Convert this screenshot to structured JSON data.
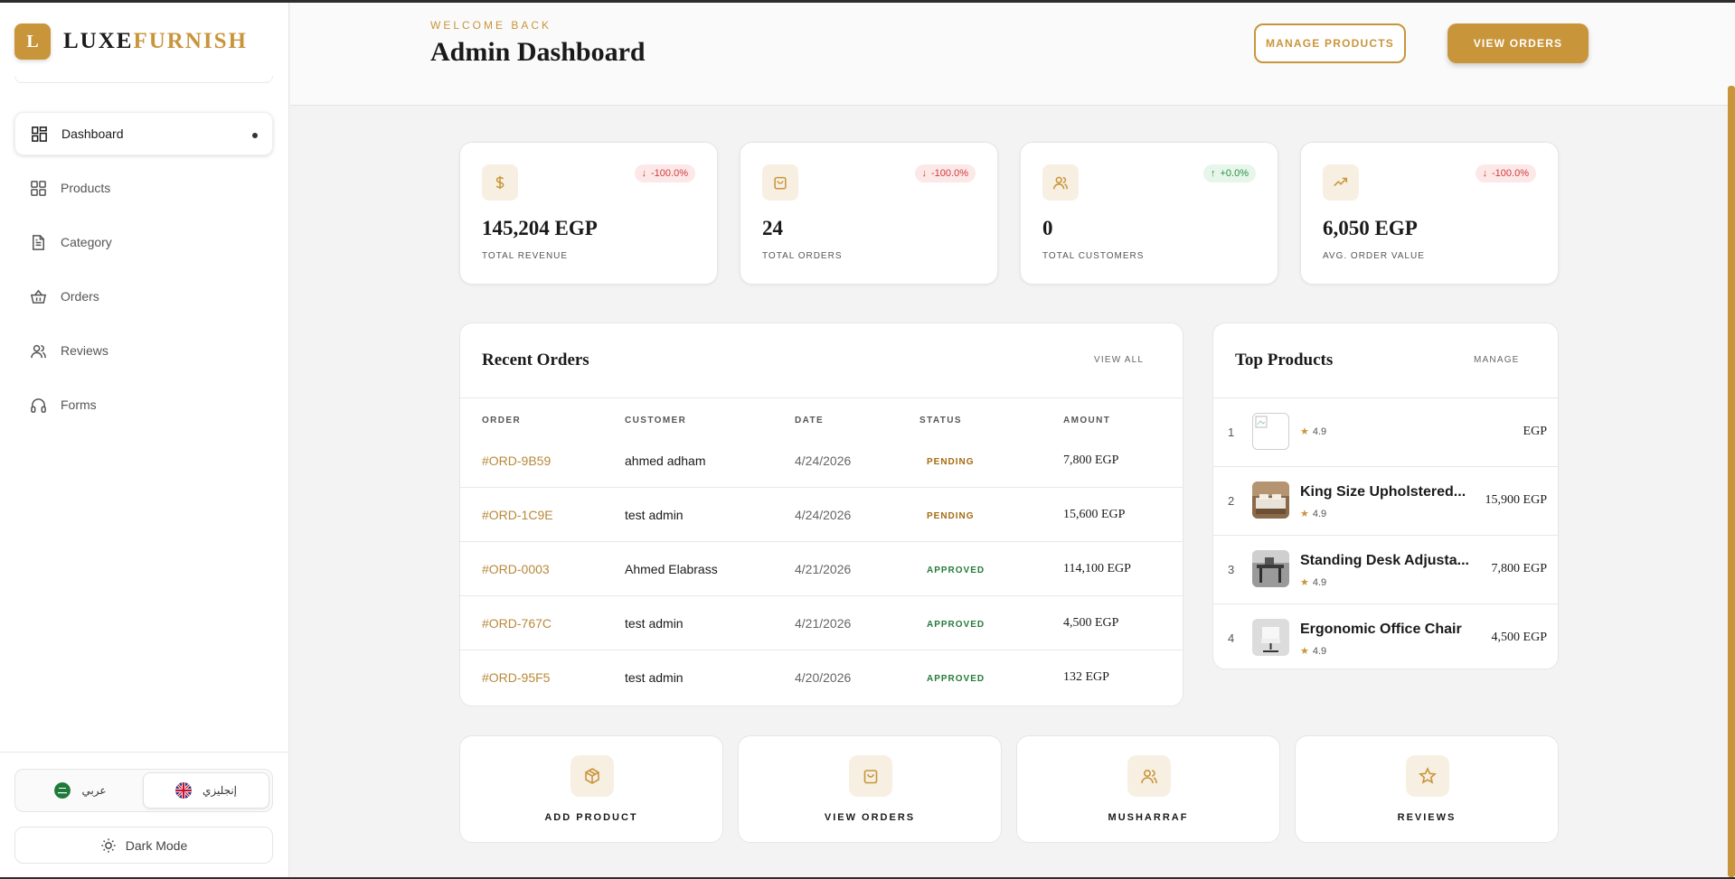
{
  "brand": {
    "logo_letter": "L",
    "name_part1": "LUXE",
    "name_part2": "FURNISH",
    "accent": "#c9953b"
  },
  "sidebar": {
    "items": [
      {
        "label": "Dashboard",
        "icon": "dashboard-icon",
        "active": true
      },
      {
        "label": "Products",
        "icon": "grid-icon"
      },
      {
        "label": "Category",
        "icon": "document-icon"
      },
      {
        "label": "Orders",
        "icon": "basket-icon"
      },
      {
        "label": "Reviews",
        "icon": "users-icon"
      },
      {
        "label": "Forms",
        "icon": "headphones-icon"
      }
    ],
    "lang_ar": "عربي",
    "lang_en": "إنجليزي",
    "dark_mode": "Dark Mode"
  },
  "header": {
    "welcome": "WELCOME BACK",
    "title": "Admin Dashboard",
    "manage_products": "MANAGE PRODUCTS",
    "view_orders": "VIEW ORDERS"
  },
  "stats": [
    {
      "value": "145,204 EGP",
      "label": "TOTAL REVENUE",
      "change": "-100.0%",
      "trend": "down",
      "icon": "dollar-icon"
    },
    {
      "value": "24",
      "label": "TOTAL ORDERS",
      "change": "-100.0%",
      "trend": "down",
      "icon": "bag-icon"
    },
    {
      "value": "0",
      "label": "TOTAL CUSTOMERS",
      "change": "+0.0%",
      "trend": "up",
      "icon": "users-icon"
    },
    {
      "value": "6,050 EGP",
      "label": "AVG. ORDER VALUE",
      "change": "-100.0%",
      "trend": "down",
      "icon": "trend-icon"
    }
  ],
  "recent_orders": {
    "title": "Recent Orders",
    "view_all": "VIEW ALL",
    "columns": [
      "ORDER",
      "CUSTOMER",
      "DATE",
      "STATUS",
      "AMOUNT"
    ],
    "rows": [
      {
        "order": "#ORD-9B59",
        "customer": "ahmed adham",
        "date": "4/24/2026",
        "status": "PENDING",
        "amount": "7,800 EGP"
      },
      {
        "order": "#ORD-1C9E",
        "customer": "test admin",
        "date": "4/24/2026",
        "status": "PENDING",
        "amount": "15,600 EGP"
      },
      {
        "order": "#ORD-0003",
        "customer": "Ahmed Elabrass",
        "date": "4/21/2026",
        "status": "APPROVED",
        "amount": "114,100 EGP"
      },
      {
        "order": "#ORD-767C",
        "customer": "test admin",
        "date": "4/21/2026",
        "status": "APPROVED",
        "amount": "4,500 EGP"
      },
      {
        "order": "#ORD-95F5",
        "customer": "test admin",
        "date": "4/20/2026",
        "status": "APPROVED",
        "amount": "132 EGP"
      }
    ]
  },
  "top_products": {
    "title": "Top Products",
    "manage": "MANAGE",
    "items": [
      {
        "rank": "1",
        "name": "",
        "rating": "4.9",
        "price": "EGP"
      },
      {
        "rank": "2",
        "name": "King Size Upholstered...",
        "rating": "4.9",
        "price": "15,900 EGP"
      },
      {
        "rank": "3",
        "name": "Standing Desk Adjusta...",
        "rating": "4.9",
        "price": "7,800 EGP"
      },
      {
        "rank": "4",
        "name": "Ergonomic Office Chair",
        "rating": "4.9",
        "price": "4,500 EGP"
      }
    ]
  },
  "quick_actions": [
    {
      "label": "ADD PRODUCT",
      "icon": "box-icon"
    },
    {
      "label": "VIEW ORDERS",
      "icon": "bag-icon"
    },
    {
      "label": "MUSHARRAF",
      "icon": "users-icon"
    },
    {
      "label": "REVIEWS",
      "icon": "star-icon"
    }
  ]
}
